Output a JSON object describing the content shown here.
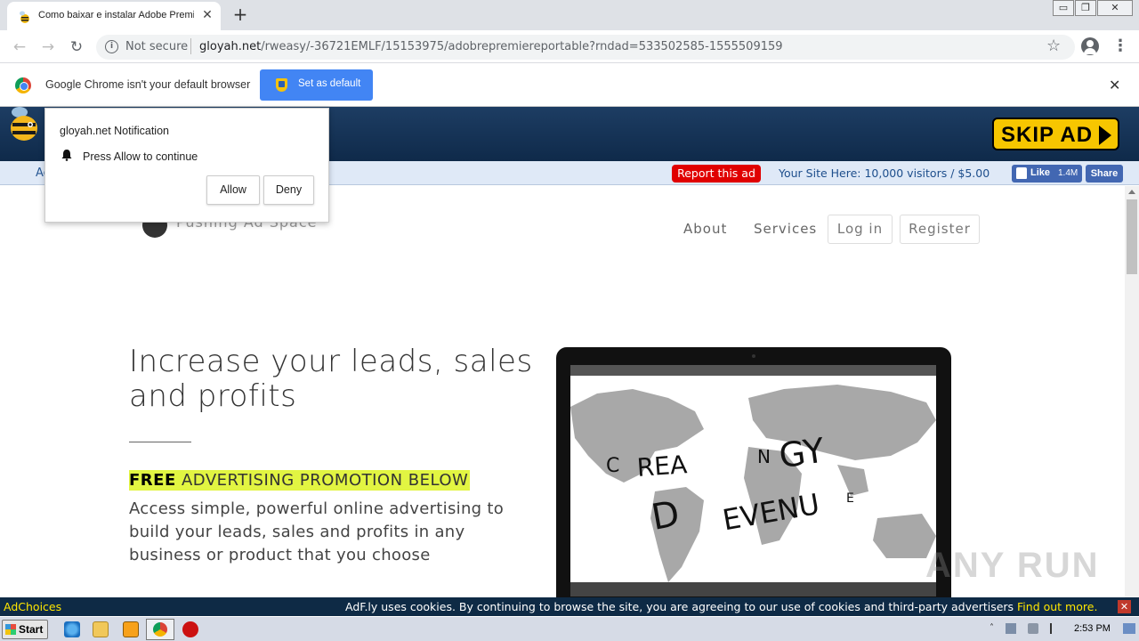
{
  "browser": {
    "tab_title": "Como baixar e instalar Adobe Premie",
    "new_tab_symbol": "+",
    "tab_close_symbol": "✕",
    "not_secure": "Not secure",
    "url_host": "gloyah.net",
    "url_path": "/rweasy/-36721EMLF/15153975/adobrepremiereportable?rndad=533502585-1555509159",
    "window_buttons": [
      "▭",
      "❐",
      "✕"
    ]
  },
  "infobar": {
    "message": "Google Chrome isn't your default browser",
    "set_default_label": "Set as default",
    "close_symbol": "✕"
  },
  "ad": {
    "skip_label": "SKIP AD",
    "left_text": "Ac",
    "report_label": "Report this ad",
    "site_here": "Your Site Here: 10,000 visitors / $5.00",
    "like_label": "Like",
    "like_count": "1.4M",
    "share_label": "Share"
  },
  "notification": {
    "title": "gloyah.net Notification",
    "message": "Press Allow to continue",
    "allow_label": "Allow",
    "deny_label": "Deny"
  },
  "site": {
    "name": "Pushing Ad Space",
    "nav": {
      "about": "About",
      "services": "Services",
      "login": "Log in",
      "register": "Register"
    },
    "headline": "Increase your leads, sales and profits",
    "promo_free": "FREE",
    "promo_rest": " ADVERTISING PROMOTION BELOW",
    "description": "Access simple, powerful online advertising to build your leads, sales and profits in any business or product that you choose"
  },
  "cookies": {
    "adchoices": "AdChoices",
    "text": "AdF.ly uses cookies. By continuing to browse the site, you are agreeing to our use of cookies and third-party advertisers ",
    "link": "Find out more.",
    "close_symbol": "✕"
  },
  "watermark": "ANY RUN",
  "taskbar": {
    "start_label": "Start",
    "time": "2:53 PM"
  }
}
